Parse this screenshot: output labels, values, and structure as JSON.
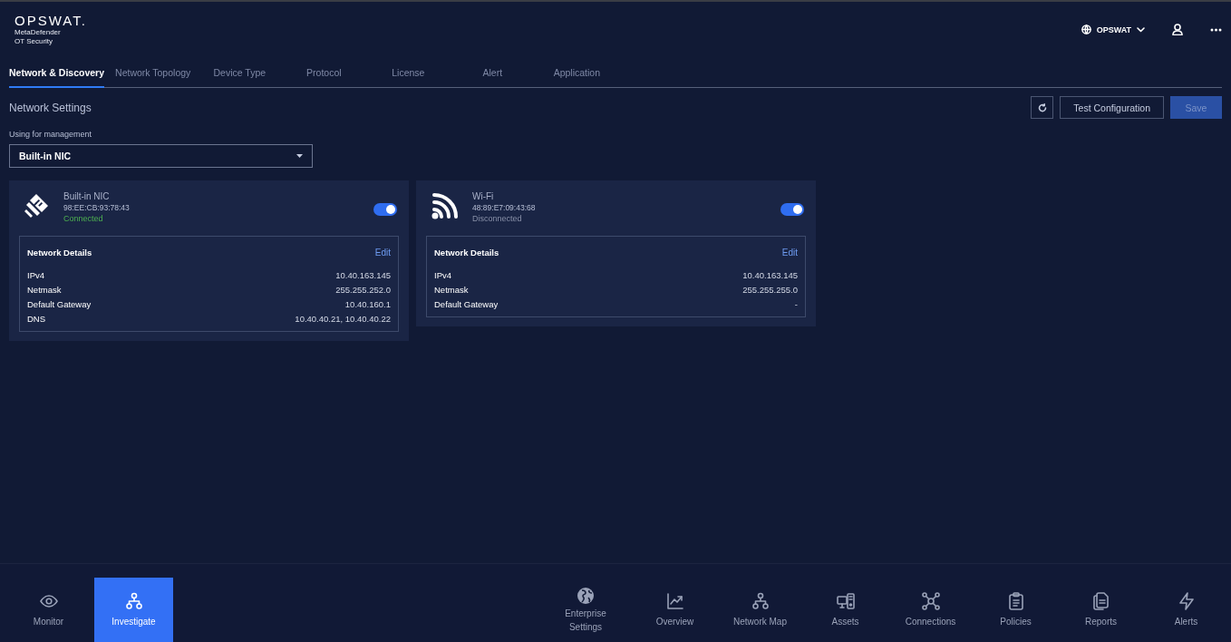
{
  "header": {
    "brand": "OPSWAT.",
    "product_lines": [
      "MetaDefender",
      "OT Security"
    ],
    "org": "OPSWAT"
  },
  "tabs": [
    {
      "label": "Network & Discovery",
      "selected": true
    },
    {
      "label": "Network Topology",
      "selected": false
    },
    {
      "label": "Device Type",
      "selected": false
    },
    {
      "label": "Protocol",
      "selected": false
    },
    {
      "label": "License",
      "selected": false
    },
    {
      "label": "Alert",
      "selected": false
    },
    {
      "label": "Application",
      "selected": false
    }
  ],
  "section": {
    "title": "Network Settings",
    "test_button": "Test Configuration",
    "save_button": {
      "label": "Save",
      "disabled": true
    }
  },
  "management": {
    "label": "Using for management",
    "value": "Built-in NIC"
  },
  "interfaces": [
    {
      "kind": "ethernet",
      "name": "Built-in NIC",
      "mac": "98:EE:CB:93:78:43",
      "status": "Connected",
      "connected": true,
      "on": true,
      "details_title": "Network Details",
      "edit": "Edit",
      "rows": [
        {
          "label": "IPv4",
          "value": "10.40.163.145"
        },
        {
          "label": "Netmask",
          "value": "255.255.252.0"
        },
        {
          "label": "Default Gateway",
          "value": "10.40.160.1"
        },
        {
          "label": "DNS",
          "value": "10.40.40.21, 10.40.40.22"
        }
      ]
    },
    {
      "kind": "wifi",
      "name": "Wi-Fi",
      "mac": "48:89:E7:09:43:68",
      "status": "Disconnected",
      "connected": false,
      "on": true,
      "details_title": "Network Details",
      "edit": "Edit",
      "rows": [
        {
          "label": "IPv4",
          "value": "10.40.163.145"
        },
        {
          "label": "Netmask",
          "value": "255.255.255.0"
        },
        {
          "label": "Default Gateway",
          "value": "-"
        }
      ]
    }
  ],
  "bottom_nav": {
    "left": [
      {
        "label": "Monitor",
        "selected": false
      },
      {
        "label": "Investigate",
        "selected": true
      }
    ],
    "right": [
      {
        "label": "Enterprise Settings",
        "selected": false
      },
      {
        "label": "Overview",
        "selected": false
      },
      {
        "label": "Network Map",
        "selected": false
      },
      {
        "label": "Assets",
        "selected": false
      },
      {
        "label": "Connections",
        "selected": false
      },
      {
        "label": "Policies",
        "selected": false
      },
      {
        "label": "Reports",
        "selected": false
      },
      {
        "label": "Alerts",
        "selected": false
      }
    ]
  }
}
